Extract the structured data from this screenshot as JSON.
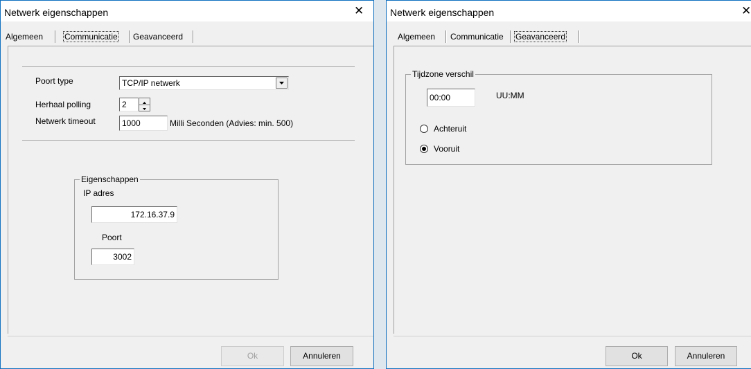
{
  "left_dialog": {
    "title": "Netwerk eigenschappen",
    "tabs": [
      "Algemeen",
      "Communicatie",
      "Geavanceerd"
    ],
    "active_tab": "Communicatie",
    "poort_type_label": "Poort type",
    "poort_type_value": "TCP/IP netwerk",
    "herhaal_polling_label": "Herhaal polling",
    "herhaal_polling_value": "2",
    "netwerk_timeout_label": "Netwerk timeout",
    "netwerk_timeout_value": "1000",
    "netwerk_timeout_unit": "Milli Seconden (Advies: min. 500)",
    "eigenschappen_legend": "Eigenschappen",
    "ip_label": "IP adres",
    "ip_value": "172.16.37.9",
    "poort_label": "Poort",
    "poort_value": "3002",
    "ok_label": "Ok",
    "cancel_label": "Annuleren"
  },
  "right_dialog": {
    "title": "Netwerk eigenschappen",
    "tabs": [
      "Algemeen",
      "Communicatie",
      "Geavanceerd"
    ],
    "active_tab": "Geavanceerd",
    "tijdzone_legend": "Tijdzone verschil",
    "time_value": "00:00",
    "time_unit": "UU:MM",
    "radio_achteruit": "Achteruit",
    "radio_vooruit": "Vooruit",
    "selected_radio": "Vooruit",
    "ok_label": "Ok",
    "cancel_label": "Annuleren"
  },
  "icons": {
    "close": "close-icon",
    "dropdown": "chevron-down-icon",
    "spin_up": "triangle-up-icon",
    "spin_down": "triangle-down-icon"
  }
}
